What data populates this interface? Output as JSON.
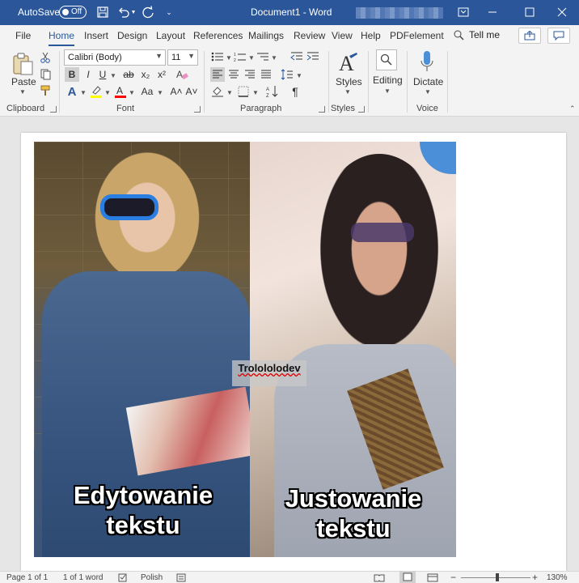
{
  "titlebar": {
    "autosave_label": "AutoSave",
    "autosave_state": "Off",
    "doc_title": "Document1  -  Word",
    "icons": [
      "save-icon",
      "undo-icon",
      "redo-icon",
      "customize-qat-icon",
      "ribbon-display-icon",
      "minimize-icon",
      "maximize-icon",
      "close-icon"
    ]
  },
  "tabs": [
    "File",
    "Home",
    "Insert",
    "Design",
    "Layout",
    "References",
    "Mailings",
    "Review",
    "View",
    "Help",
    "PDFelement"
  ],
  "active_tab": "Home",
  "tell_me": "Tell me",
  "ribbon": {
    "clipboard": {
      "paste_label": "Paste",
      "group_label": "Clipboard"
    },
    "font": {
      "font_name": "Calibri (Body)",
      "font_size": "11",
      "group_label": "Font",
      "bold": "B",
      "italic": "I",
      "underline": "U",
      "strike": "ab",
      "sub": "x₂",
      "sup": "x²",
      "case": "Aa",
      "grow": "A˄",
      "shrink": "A˅"
    },
    "paragraph": {
      "group_label": "Paragraph"
    },
    "styles": {
      "label": "Styles",
      "group_label": "Styles"
    },
    "editing": {
      "label": "Editing"
    },
    "voice": {
      "label": "Dictate",
      "group_label": "Voice"
    }
  },
  "document": {
    "caption_left": "Edytowanie tekstu",
    "caption_right": "Justowanie tekstu",
    "watermark": "Trolololodev"
  },
  "statusbar": {
    "page": "Page 1 of 1",
    "words": "1 of 1 word",
    "language": "Polish",
    "zoom": "130%"
  },
  "colors": {
    "accent": "#2b579a",
    "highlight": "#ffff00",
    "font_color": "#ff0000"
  }
}
